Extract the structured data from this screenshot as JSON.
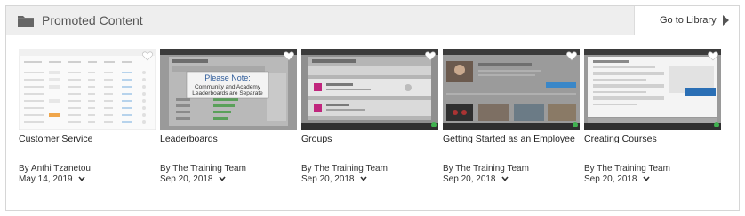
{
  "header": {
    "title": "Promoted Content",
    "icon": "folder-icon",
    "library_label": "Go to Library"
  },
  "cards": [
    {
      "title": "Customer Service",
      "author": "By Anthi Tzanetou",
      "date": "May 14, 2019"
    },
    {
      "title": "Leaderboards",
      "author": "By The Training Team",
      "date": "Sep 20, 2018",
      "thumb_note": [
        "Please Note:",
        "Community and Academy",
        "Leaderboards are Separate"
      ]
    },
    {
      "title": "Groups",
      "author": "By The Training Team",
      "date": "Sep 20, 2018"
    },
    {
      "title": "Getting Started as an Employee",
      "author": "By The Training Team",
      "date": "Sep 20, 2018"
    },
    {
      "title": "Creating Courses",
      "author": "By The Training Team",
      "date": "Sep 20, 2018"
    }
  ],
  "colors": {
    "header_bg": "#eeeeee",
    "border": "#d6d6d6",
    "accent_green": "#3fb24f",
    "accent_magenta": "#c0267d",
    "accent_blue": "#2b6fb5"
  }
}
